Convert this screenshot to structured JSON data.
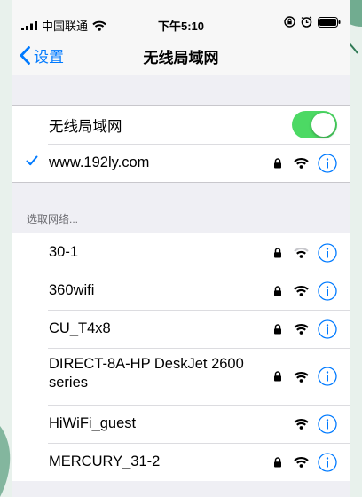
{
  "status_bar": {
    "carrier": "中国联通",
    "time": "下午5:10"
  },
  "nav": {
    "back_label": "设置",
    "title": "无线局域网"
  },
  "wlan_toggle": {
    "label": "无线局域网",
    "on": true
  },
  "connected": {
    "name": "www.192ly.com",
    "locked": true
  },
  "section_header": "选取网络...",
  "networks": [
    {
      "name": "30-1",
      "locked": true,
      "signal": "weak"
    },
    {
      "name": "360wifi",
      "locked": true,
      "signal": "full"
    },
    {
      "name": "CU_T4x8",
      "locked": true,
      "signal": "full"
    },
    {
      "name_line1": "DIRECT-8A-HP DeskJet 2600",
      "name_line2": "series",
      "locked": true,
      "signal": "full"
    },
    {
      "name": "HiWiFi_guest",
      "locked": false,
      "signal": "full"
    },
    {
      "name": "MERCURY_31-2",
      "locked": true,
      "signal": "full"
    }
  ],
  "colors": {
    "accent": "#007aff",
    "toggle_on": "#4cd964",
    "background": "#efeff4"
  },
  "icons": [
    "signal-bars-icon",
    "wifi-icon",
    "lock-rotation-icon",
    "alarm-icon",
    "battery-icon",
    "chevron-left-icon",
    "checkmark-icon",
    "lock-icon",
    "info-icon"
  ]
}
